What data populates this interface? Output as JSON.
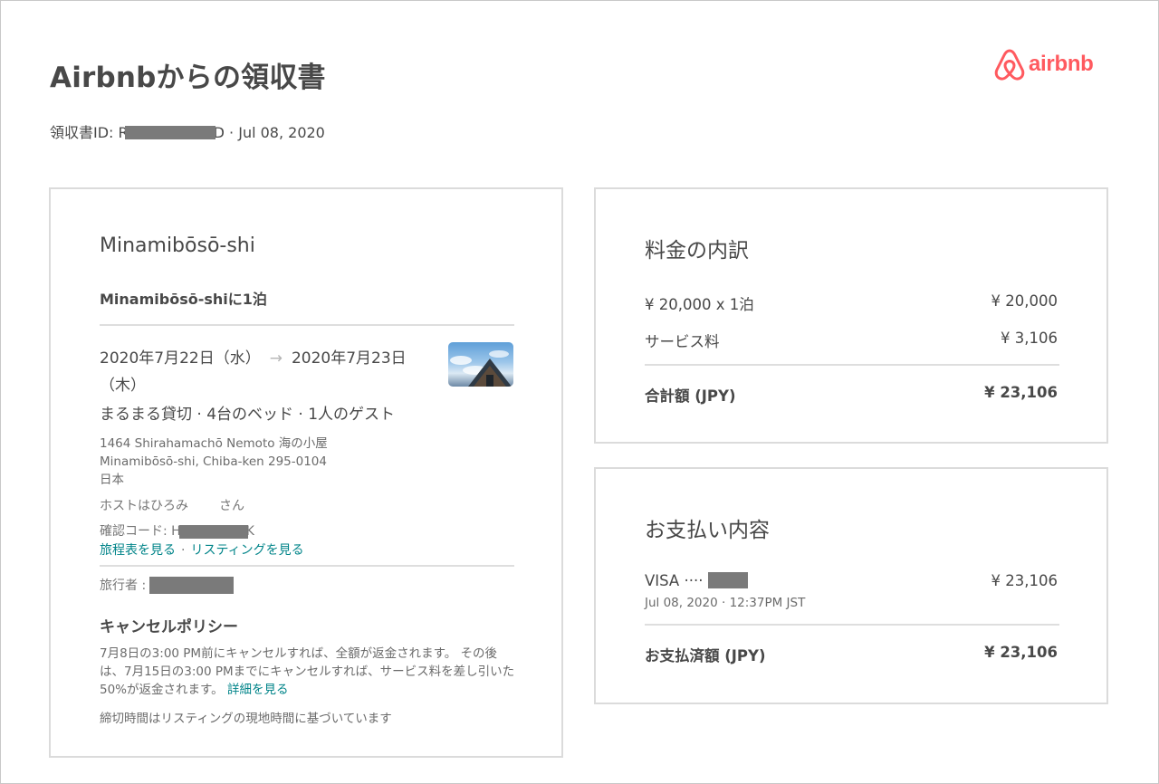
{
  "header": {
    "title": "Airbnbからの領収書",
    "receipt_id_prefix": "領収書ID: R",
    "receipt_id_suffix": "D · Jul 08, 2020",
    "logo_text": "airbnb",
    "brand_color": "#ff5a5f"
  },
  "trip": {
    "city": "Minamibōsō-shi",
    "nights": "Minamibōsō-shiに1泊",
    "date_from": "2020年7月22日（水）",
    "date_arrow": "→",
    "date_to": "2020年7月23日（木）",
    "room_summary": "まるまる貸切 · 4台のベッド · 1人のゲスト",
    "address_line1": "1464 Shirahamachō Nemoto 海の小屋",
    "address_line2": "Minamibōsō-shi, Chiba-ken 295-0104",
    "address_line3": "日本",
    "host_prefix": "ホストはひろみ",
    "host_suffix": "さん",
    "confirm_prefix": "確認コード: H",
    "confirm_suffix": "K",
    "link_itinerary": "旅程表を見る",
    "link_separator": "·",
    "link_listing": "リスティングを見る",
    "traveler_label": "旅行者 :",
    "cancel_title": "キャンセルポリシー",
    "cancel_text": "7月8日の3:00 PM前にキャンセルすれば、全額が返金されます。 その後は、7月15日の3:00 PMまでにキャンセルすれば、サービス料を差し引いた50%が返金されます。",
    "cancel_link": "詳細を見る",
    "deadline_note": "締切時間はリスティングの現地時間に基づいています"
  },
  "price": {
    "title": "料金の内訳",
    "rows": [
      {
        "label": "¥ 20,000 x 1泊",
        "amount": "¥ 20,000"
      },
      {
        "label": "サービス料",
        "amount": "¥ 3,106"
      }
    ],
    "total_label": "合計額 (JPY)",
    "total_amount": "¥ 23,106"
  },
  "payment": {
    "title": "お支払い内容",
    "card_label": "VISA ····",
    "card_amount": "¥ 23,106",
    "timestamp": "Jul 08, 2020 · 12:37PM JST",
    "paid_label": "お支払済額 (JPY)",
    "paid_amount": "¥ 23,106"
  }
}
